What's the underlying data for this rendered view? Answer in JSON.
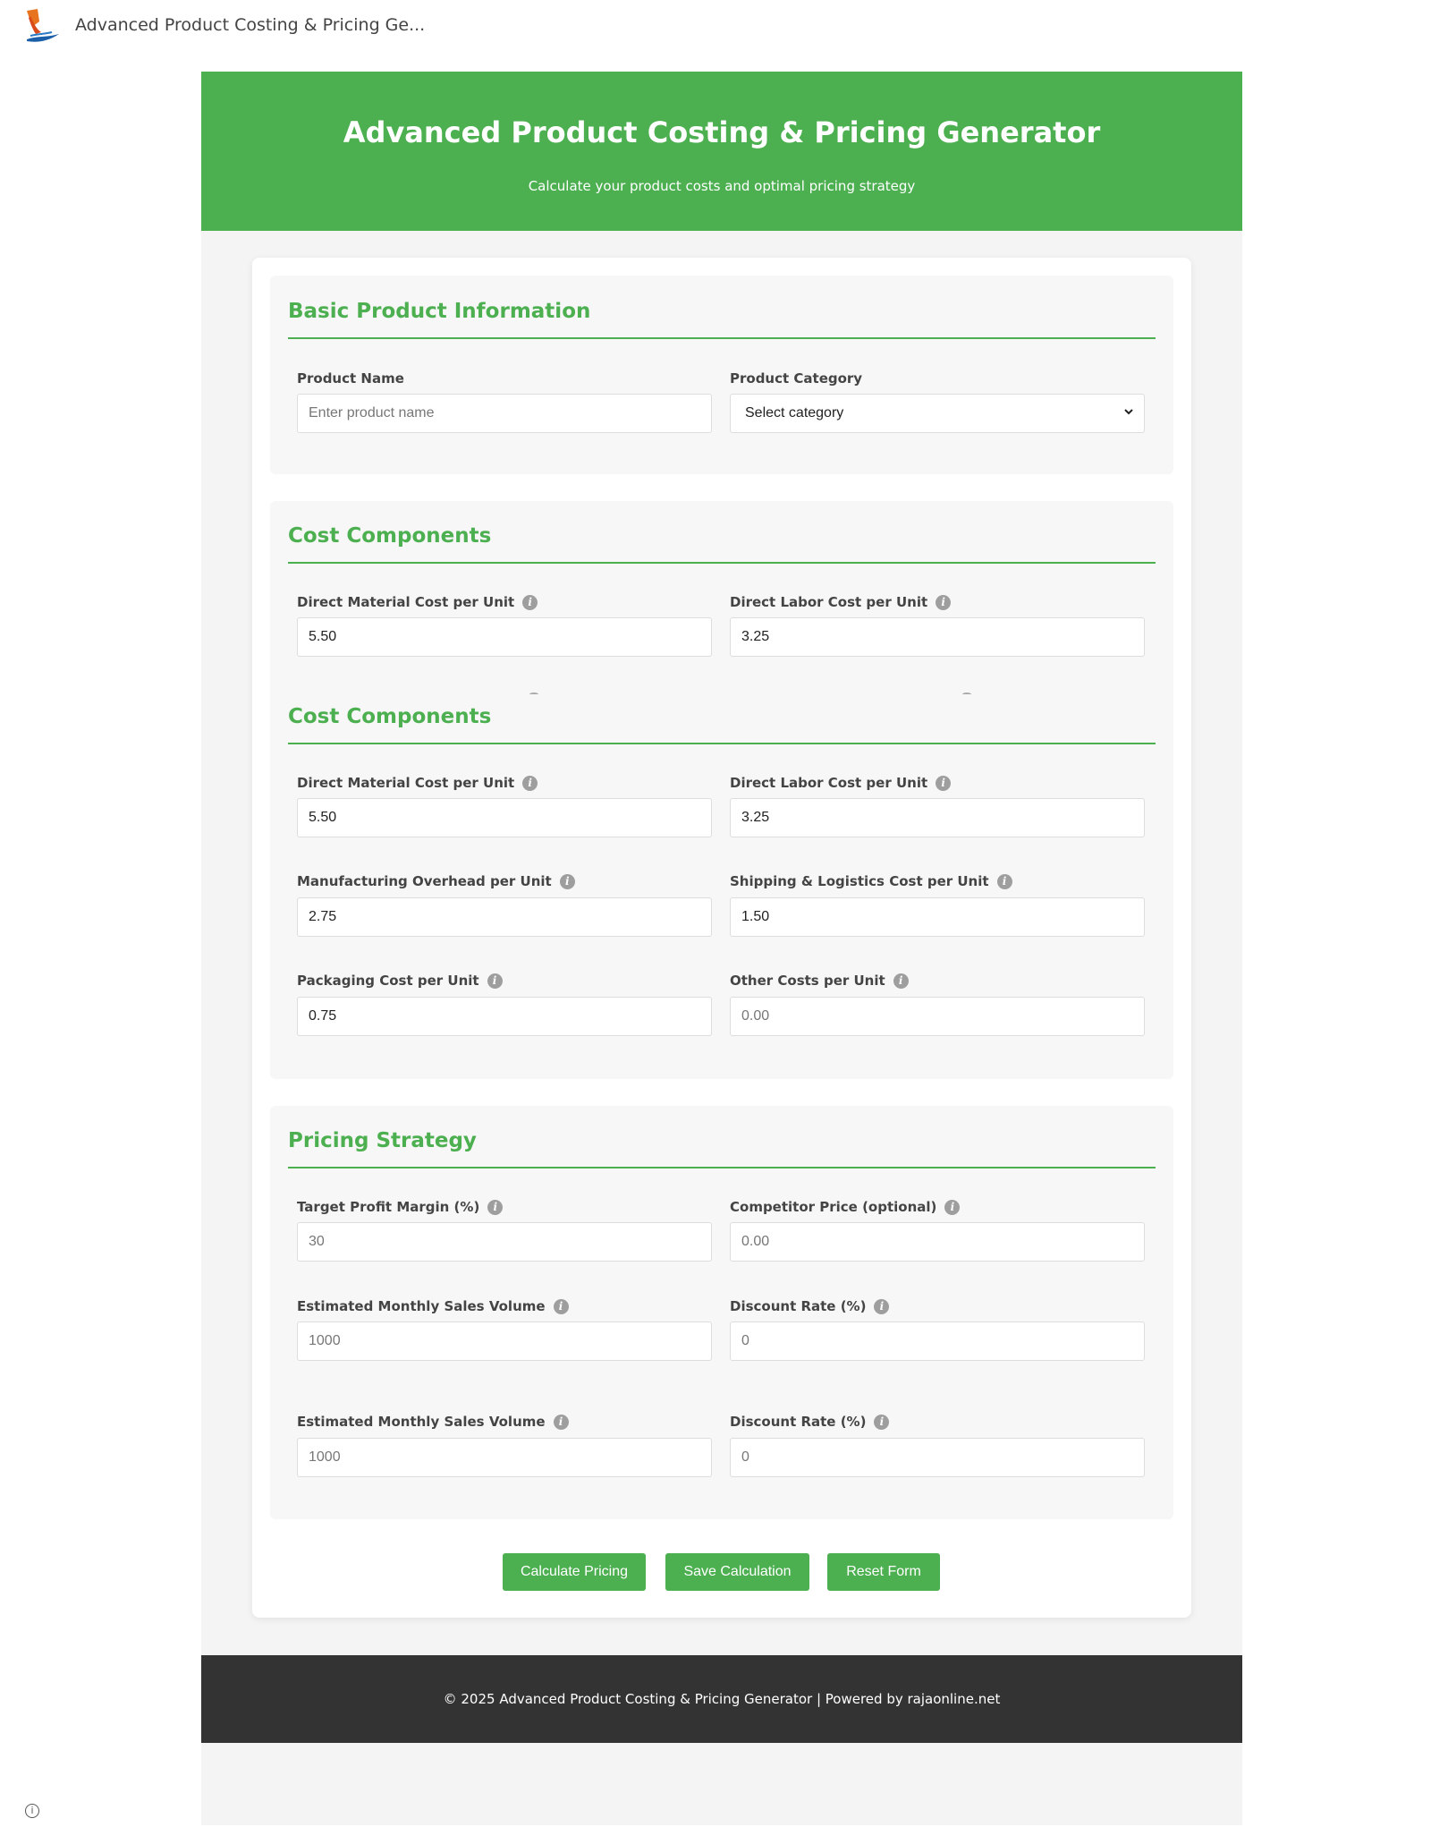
{
  "browser": {
    "tab_title": "Advanced Product Costing & Pricing Ge..."
  },
  "header": {
    "title": "Advanced Product Costing & Pricing Generator",
    "subtitle": "Calculate your product costs and optimal pricing strategy"
  },
  "basic_info": {
    "title": "Basic Product Information",
    "product_name_label": "Product Name",
    "product_name_placeholder": "Enter product name",
    "category_label": "Product Category",
    "category_selected": "Select category"
  },
  "cost_components_a": {
    "title": "Cost Components",
    "material_label": "Direct Material Cost per Unit",
    "material_value": "5.50",
    "labor_label": "Direct Labor Cost per Unit",
    "labor_value": "3.25"
  },
  "cost_components_b": {
    "title": "Cost Components",
    "material_label": "Direct Material Cost per Unit",
    "material_value": "5.50",
    "labor_label": "Direct Labor Cost per Unit",
    "labor_value": "3.25",
    "overhead_label": "Manufacturing Overhead per Unit",
    "overhead_value": "2.75",
    "shipping_label": "Shipping & Logistics Cost per Unit",
    "shipping_value": "1.50",
    "packaging_label": "Packaging Cost per Unit",
    "packaging_value": "0.75",
    "other_label": "Other Costs per Unit",
    "other_placeholder": "0.00"
  },
  "pricing": {
    "title": "Pricing Strategy",
    "margin_label": "Target Profit Margin (%)",
    "margin_placeholder": "30",
    "competitor_label": "Competitor Price (optional)",
    "competitor_placeholder": "0.00",
    "volume_label": "Estimated Monthly Sales Volume",
    "volume_placeholder": "1000",
    "discount_label": "Discount Rate (%)",
    "discount_placeholder": "0",
    "volume_label_2": "Estimated Monthly Sales Volume",
    "volume_placeholder_2": "1000",
    "discount_label_2": "Discount Rate (%)",
    "discount_placeholder_2": "0"
  },
  "buttons": {
    "calculate": "Calculate Pricing",
    "save": "Save Calculation",
    "reset": "Reset Form"
  },
  "footer": {
    "text": "© 2025 Advanced Product Costing & Pricing Generator | Powered by rajaonline.net"
  },
  "colors": {
    "accent": "#4caf50",
    "footer_bg": "#333333",
    "shell_bg": "#f4f4f4"
  },
  "icons": [
    "site-logo-icon",
    "info-icon",
    "chevron-down-icon",
    "page-info-icon"
  ]
}
